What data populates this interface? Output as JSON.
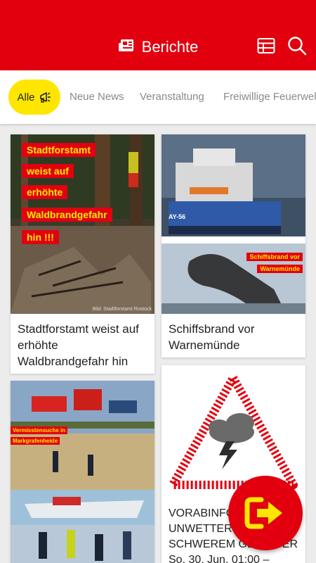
{
  "appbar": {
    "title": "Berichte",
    "icons": [
      "newspaper-icon",
      "table-view-icon",
      "search-icon"
    ],
    "color": "#e2000f"
  },
  "tabs": {
    "active": "Alle",
    "items": [
      "Neue News",
      "Veranstaltung",
      "Freiwillige Feuerwehr"
    ],
    "active_color": "#ffe600"
  },
  "cards": [
    {
      "caption": "Stadtforstamt weist auf erhöhte Waldbrandgefahr hin",
      "overlay_lines": [
        "Stadtforstamt",
        "weist auf",
        "erhöhte",
        "Waldbrandgefahr",
        "hin !!!"
      ],
      "credit": "Bild: Stadtforstamt Rostock"
    },
    {
      "caption": "Schiffsbrand vor Warnemünde",
      "overlay_lines": [
        "Schiffsbrand vor",
        "Warnemünde"
      ],
      "boat_id": "AY-56"
    },
    {
      "caption": "",
      "overlay_lines": [
        "Vermisstensuche in",
        "Markgrafenheide"
      ]
    },
    {
      "caption_lines": [
        "VORABINFORMATION:",
        "UNWETTER MIT",
        "SCHWEREM GEWITTER",
        "So. 30. Jun. 01:00 –"
      ]
    }
  ],
  "fab": {
    "icon": "logout-icon",
    "icon_color": "#ffe600"
  }
}
